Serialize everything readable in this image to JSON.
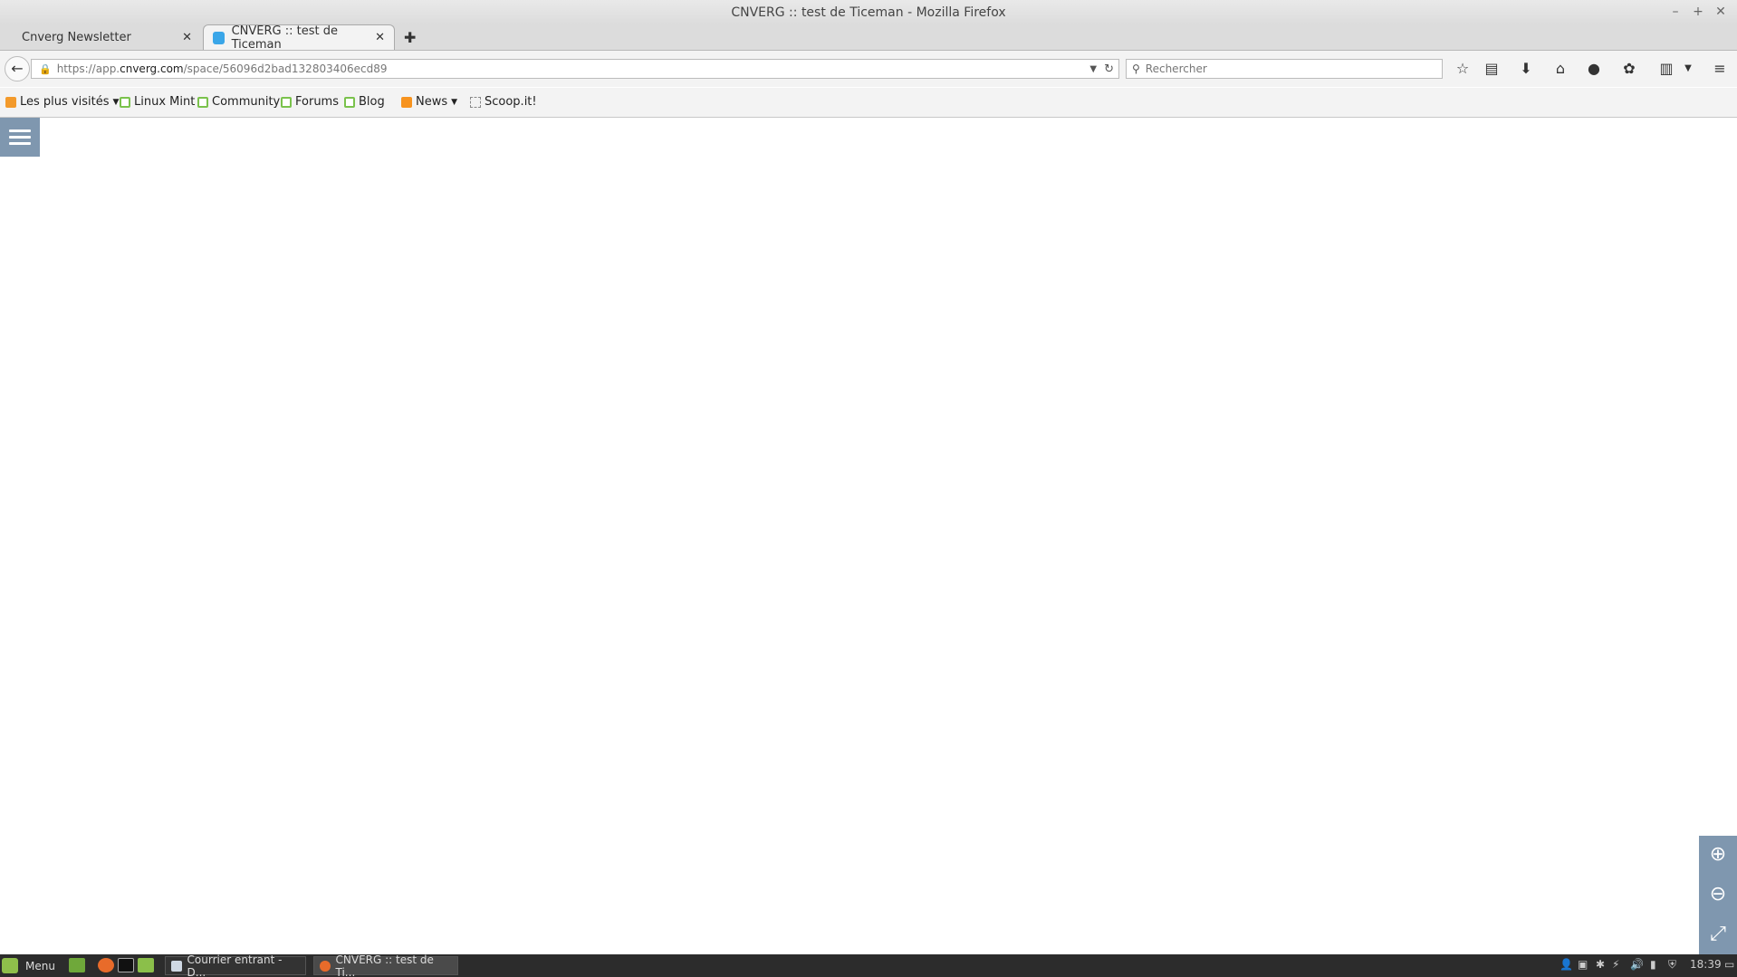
{
  "window": {
    "title": "CNVERG :: test de Ticeman - Mozilla Firefox",
    "controls": [
      "–",
      "+",
      "✕"
    ]
  },
  "tabs": [
    {
      "label": "Cnverg Newsletter",
      "active": false
    },
    {
      "label": "CNVERG :: test de Ticeman",
      "active": true
    }
  ],
  "tab_close_symbol": "✕",
  "new_tab_symbol": "✚",
  "navbar": {
    "url_prefix": "https://app.",
    "url_host": "cnverg.com",
    "url_path": "/space/56096d2bad132803406ecd89",
    "search_placeholder": "Rechercher"
  },
  "toolbar_icons": [
    "star-icon",
    "reading-list-icon",
    "download-icon",
    "home-icon",
    "chat-icon",
    "extension-icon",
    "clipboard-icon",
    "menu-icon"
  ],
  "bookmarks": [
    {
      "label": "Les plus visités",
      "icon": "most-visited-icon",
      "dropdown": true
    },
    {
      "label": "Linux Mint",
      "icon": "mint-icon",
      "dropdown": false
    },
    {
      "label": "Community",
      "icon": "mint-icon",
      "dropdown": false
    },
    {
      "label": "Forums",
      "icon": "mint-icon",
      "dropdown": false
    },
    {
      "label": "Blog",
      "icon": "mint-icon",
      "dropdown": false
    },
    {
      "label": "News",
      "icon": "rss-icon",
      "dropdown": true
    },
    {
      "label": "Scoop.it!",
      "icon": "scoopit-icon",
      "dropdown": false
    }
  ],
  "page": {
    "accent_color": "#7f97af"
  },
  "taskbar": {
    "menu_label": "Menu",
    "tasks": [
      {
        "label": "Courrier entrant - D...",
        "active": false
      },
      {
        "label": "CNVERG :: test de Ti...",
        "active": true
      }
    ],
    "clock": "18:39"
  }
}
